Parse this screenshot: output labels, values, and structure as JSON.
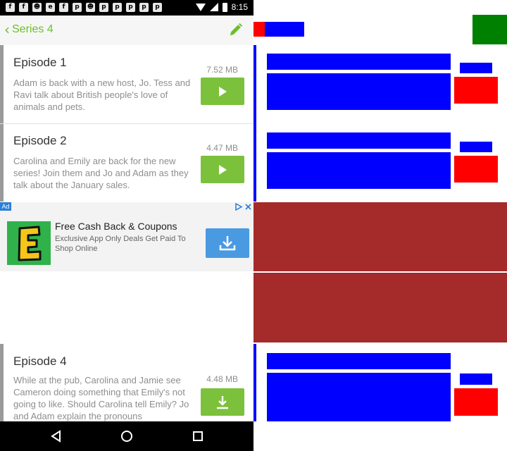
{
  "status_bar": {
    "time": "8:15",
    "notification_icons": [
      "facebook-icon",
      "facebook-icon",
      "game-icon",
      "esc-icon",
      "facebook-icon",
      "pinterest-icon",
      "game-icon",
      "pinterest-icon",
      "pinterest-icon",
      "pinterest-icon",
      "pinterest-icon",
      "pinterest-icon"
    ]
  },
  "app_bar": {
    "title": "Series 4",
    "back_icon": "chevron-left-icon",
    "edit_icon": "pencil-icon"
  },
  "episodes": [
    {
      "title": "Episode 1",
      "description": "Adam is back with a new host, Jo. Tess and Ravi talk about British people's love of animals and pets.",
      "size": "7.52 MB",
      "action_icon": "play-icon"
    },
    {
      "title": "Episode 2",
      "description": "Carolina and Emily are back for the new series! Join them and Jo and Adam as they talk about the January sales.",
      "size": "4.47 MB",
      "action_icon": "play-icon"
    },
    {
      "title": "Episode 4",
      "description": "While at the pub, Carolina and Jamie see Cameron doing something that Emily's not going to like. Should Carolina tell Emily? Jo and Adam explain the pronouns",
      "size": "4.48 MB",
      "action_icon": "download-icon"
    }
  ],
  "ad": {
    "badge": "Ad",
    "title": "Free Cash Back & Coupons",
    "text": "Exclusive App Only Deals Get Paid To Shop Online",
    "logo_letter": "E",
    "download_icon": "download-icon"
  },
  "colors": {
    "accent_green": "#7cc13c",
    "title_green": "#6cbf2a",
    "ad_blue": "#4a9ae2",
    "annot_blue": "#0000ff",
    "annot_red": "#ff0000",
    "annot_green": "#008000",
    "annot_darkred": "#a52a2a"
  }
}
